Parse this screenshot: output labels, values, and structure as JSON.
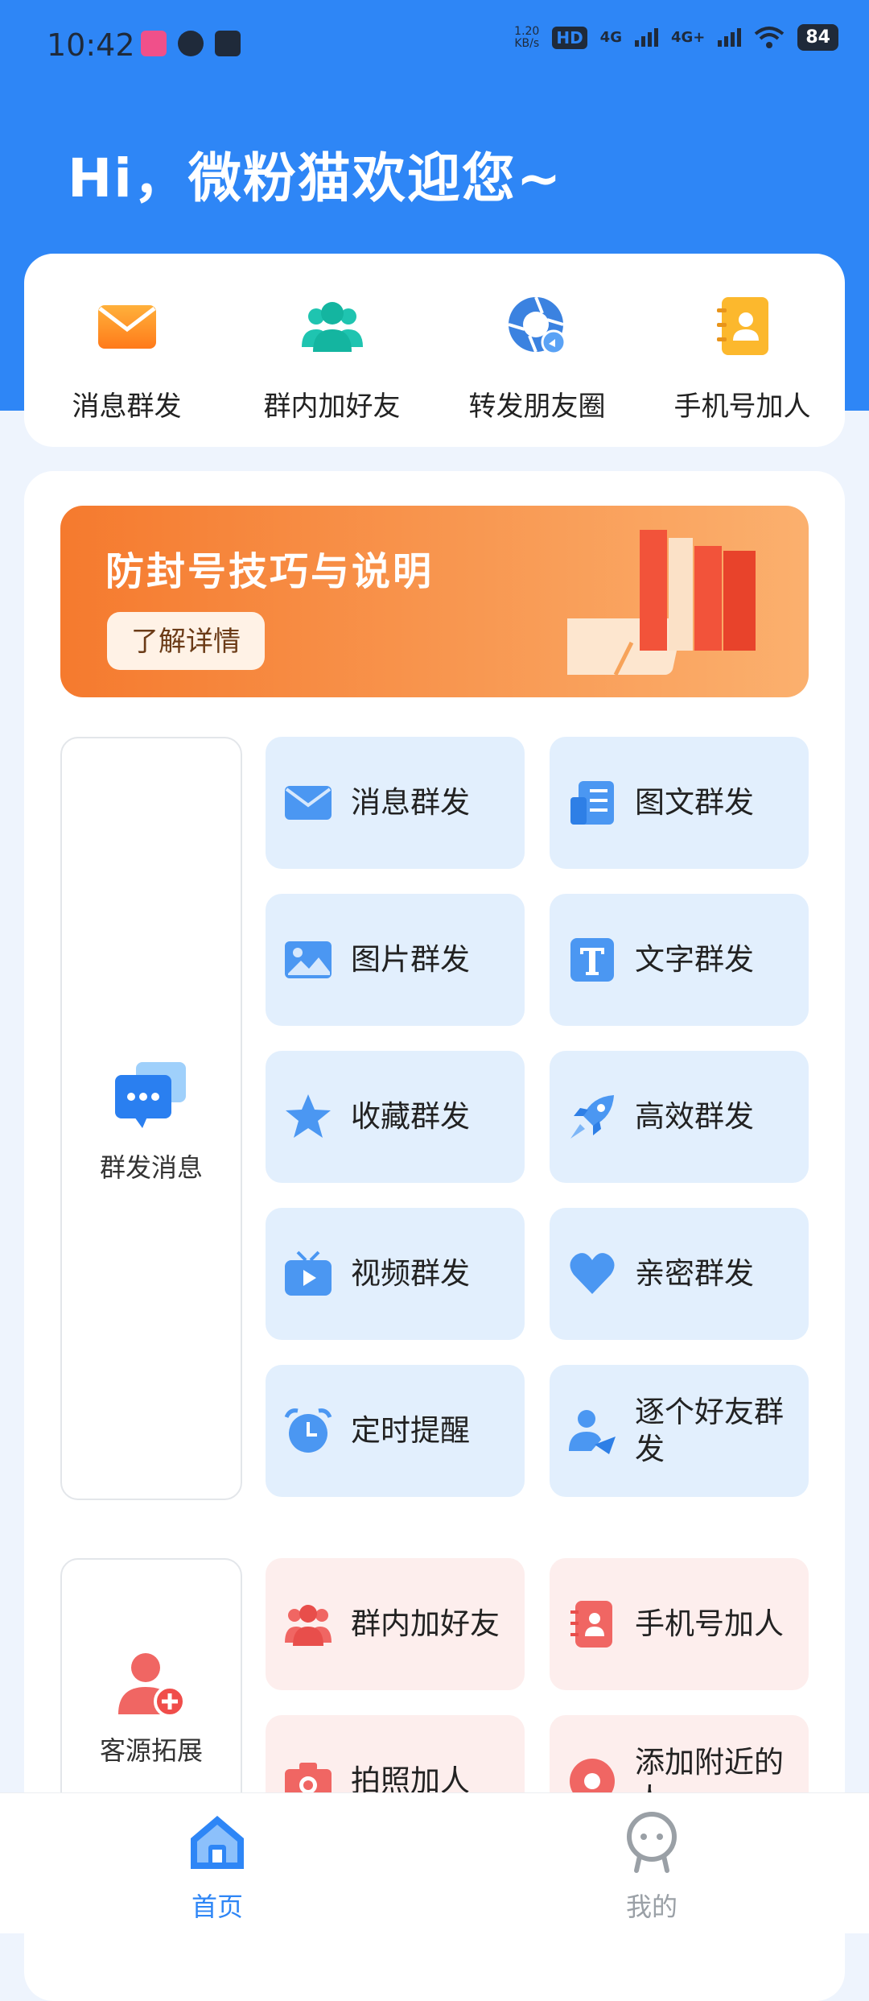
{
  "status_bar": {
    "time": "10:42",
    "speed_top": "1.20",
    "speed_unit": "KB/s",
    "hd": "HD",
    "net1": "4G",
    "net2": "4G+",
    "battery": "84"
  },
  "greeting": "Hi，微粉猫欢迎您~",
  "quick_actions": [
    {
      "label": "消息群发",
      "icon": "envelope-icon"
    },
    {
      "label": "群内加好友",
      "icon": "group-icon"
    },
    {
      "label": "转发朋友圈",
      "icon": "camera-aperture-icon"
    },
    {
      "label": "手机号加人",
      "icon": "contact-book-icon"
    }
  ],
  "banner": {
    "title": "防封号技巧与说明",
    "button": "了解详情"
  },
  "section_broadcast": {
    "label": "群发消息",
    "tiles": [
      {
        "label": "消息群发",
        "icon": "envelope-icon"
      },
      {
        "label": "图文群发",
        "icon": "image-text-icon"
      },
      {
        "label": "图片群发",
        "icon": "picture-icon"
      },
      {
        "label": "文字群发",
        "icon": "text-t-icon"
      },
      {
        "label": "收藏群发",
        "icon": "star-icon"
      },
      {
        "label": "高效群发",
        "icon": "rocket-icon"
      },
      {
        "label": "视频群发",
        "icon": "tv-play-icon"
      },
      {
        "label": "亲密群发",
        "icon": "heart-icon"
      },
      {
        "label": "定时提醒",
        "icon": "alarm-clock-icon"
      },
      {
        "label": "逐个好友群发",
        "icon": "user-send-icon"
      }
    ]
  },
  "section_leads": {
    "label": "客源拓展",
    "tiles": [
      {
        "label": "群内加好友",
        "icon": "group-icon"
      },
      {
        "label": "手机号加人",
        "icon": "contact-book-icon"
      },
      {
        "label": "拍照加人",
        "icon": "camera-icon"
      },
      {
        "label": "添加附近的人",
        "icon": "location-pin-icon"
      }
    ]
  },
  "tabbar": {
    "home": "首页",
    "mine": "我的"
  },
  "colors": {
    "brand_blue": "#2e86f6",
    "banner_orange": "#f57a2e",
    "tile_blue": "#e2effd",
    "tile_pink": "#fdeeed",
    "tab_active": "#2e86f6",
    "tab_inactive": "#9aa0a6"
  }
}
